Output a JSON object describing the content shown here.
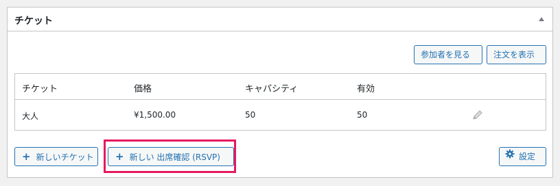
{
  "panel": {
    "title": "チケット"
  },
  "actions": {
    "view_attendees": "参加者を見る",
    "view_orders": "注文を表示"
  },
  "table": {
    "headers": [
      "チケット",
      "価格",
      "キャパシティ",
      "有効"
    ],
    "rows": [
      {
        "ticket": "大人",
        "price": "¥1,500.00",
        "capacity": "50",
        "available": "50"
      }
    ]
  },
  "footer": {
    "new_ticket": "新しいチケット",
    "new_rsvp": "新しい 出席確認 (RSVP)",
    "settings": "設定"
  },
  "icons": {
    "toggle": "caret-up-icon",
    "edit": "pencil-icon",
    "add": "plus-icon",
    "settings": "gear-icon"
  },
  "colors": {
    "accent": "#2271b1",
    "highlight": "#e5195f",
    "border": "#c3c4c7"
  }
}
